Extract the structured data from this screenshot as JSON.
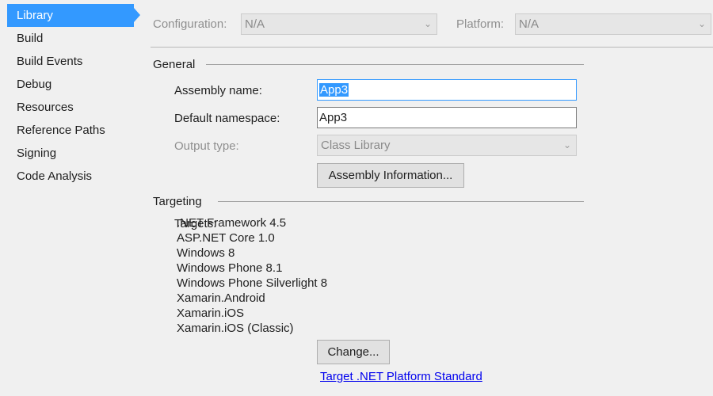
{
  "sidebar": {
    "items": [
      {
        "label": "Library",
        "active": true
      },
      {
        "label": "Build"
      },
      {
        "label": "Build Events"
      },
      {
        "label": "Debug"
      },
      {
        "label": "Resources"
      },
      {
        "label": "Reference Paths"
      },
      {
        "label": "Signing"
      },
      {
        "label": "Code Analysis"
      }
    ]
  },
  "toolbar": {
    "configuration_label": "Configuration:",
    "configuration_value": "N/A",
    "platform_label": "Platform:",
    "platform_value": "N/A"
  },
  "general": {
    "title": "General",
    "assembly_name_label": "Assembly name:",
    "assembly_name_value": "App3",
    "default_namespace_label": "Default namespace:",
    "default_namespace_value": "App3",
    "output_type_label": "Output type:",
    "output_type_value": "Class Library",
    "assembly_info_button": "Assembly Information..."
  },
  "targeting": {
    "title": "Targeting",
    "targets_label": "Targets:",
    "targets": [
      ".NET Framework 4.5",
      "ASP.NET Core 1.0",
      "Windows 8",
      "Windows Phone 8.1",
      "Windows Phone Silverlight 8",
      "Xamarin.Android",
      "Xamarin.iOS",
      "Xamarin.iOS (Classic)"
    ],
    "change_button": "Change...",
    "platform_standard_link": "Target .NET Platform Standard"
  },
  "icons": {
    "dropdown": "chevron-down-icon"
  },
  "colors": {
    "accent": "#3399ff",
    "link": "#0000ee"
  }
}
